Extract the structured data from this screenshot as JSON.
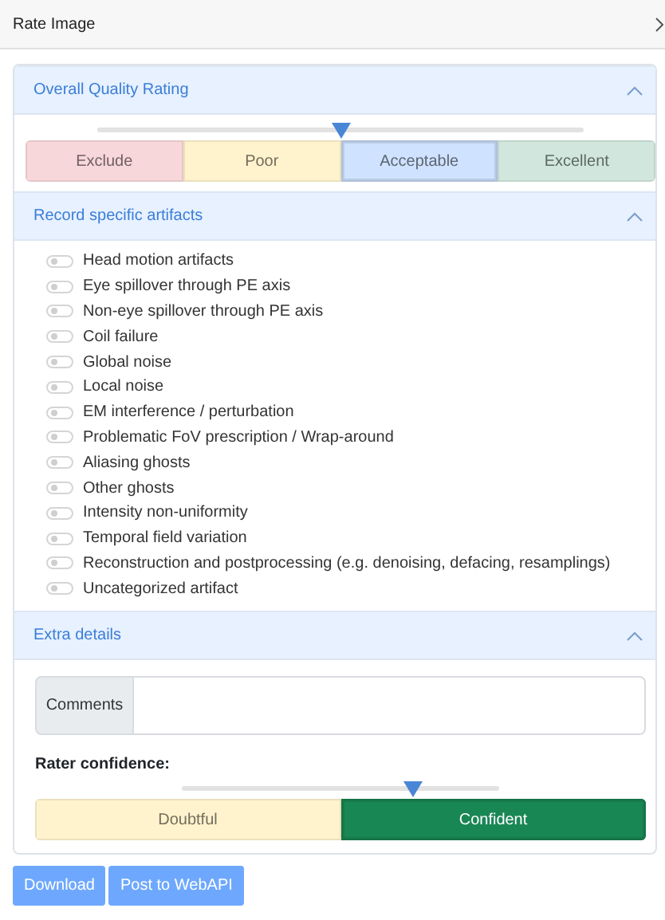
{
  "header": {
    "title": "Rate Image"
  },
  "quality": {
    "title": "Overall Quality Rating",
    "expanded": true,
    "level": 0.5,
    "options": [
      {
        "label": "Exclude",
        "color": "#f8d7da",
        "selected": false
      },
      {
        "label": "Poor",
        "color": "#fff3cd",
        "selected": false
      },
      {
        "label": "Acceptable",
        "color": "#cfe2ff",
        "selected": true
      },
      {
        "label": "Excellent",
        "color": "#d1e7dd",
        "selected": false
      }
    ]
  },
  "artifacts": {
    "title": "Record specific artifacts",
    "expanded": true,
    "items": [
      {
        "label": "Head motion artifacts",
        "checked": false
      },
      {
        "label": "Eye spillover through PE axis",
        "checked": false
      },
      {
        "label": "Non-eye spillover through PE axis",
        "checked": false
      },
      {
        "label": "Coil failure",
        "checked": false
      },
      {
        "label": "Global noise",
        "checked": false
      },
      {
        "label": "Local noise",
        "checked": false
      },
      {
        "label": "EM interference / perturbation",
        "checked": false
      },
      {
        "label": "Problematic FoV prescription / Wrap-around",
        "checked": false
      },
      {
        "label": "Aliasing ghosts",
        "checked": false
      },
      {
        "label": "Other ghosts",
        "checked": false
      },
      {
        "label": "Intensity non-uniformity",
        "checked": false
      },
      {
        "label": "Temporal field variation",
        "checked": false
      },
      {
        "label": "Reconstruction and postprocessing (e.g. denoising, defacing, resamplings)",
        "checked": false
      },
      {
        "label": "Uncategorized artifact",
        "checked": false
      }
    ]
  },
  "extra": {
    "title": "Extra details",
    "expanded": true,
    "comments_label": "Comments",
    "confidence_label": "Rater confidence:",
    "confidence": {
      "level": 0.73,
      "options": [
        {
          "label": "Doubtful",
          "color": "#fff3cd",
          "selected": false
        },
        {
          "label": "Confident",
          "color": "#198754",
          "selected": true
        }
      ]
    }
  },
  "buttons": [
    "Download",
    "Post to WebAPI"
  ]
}
